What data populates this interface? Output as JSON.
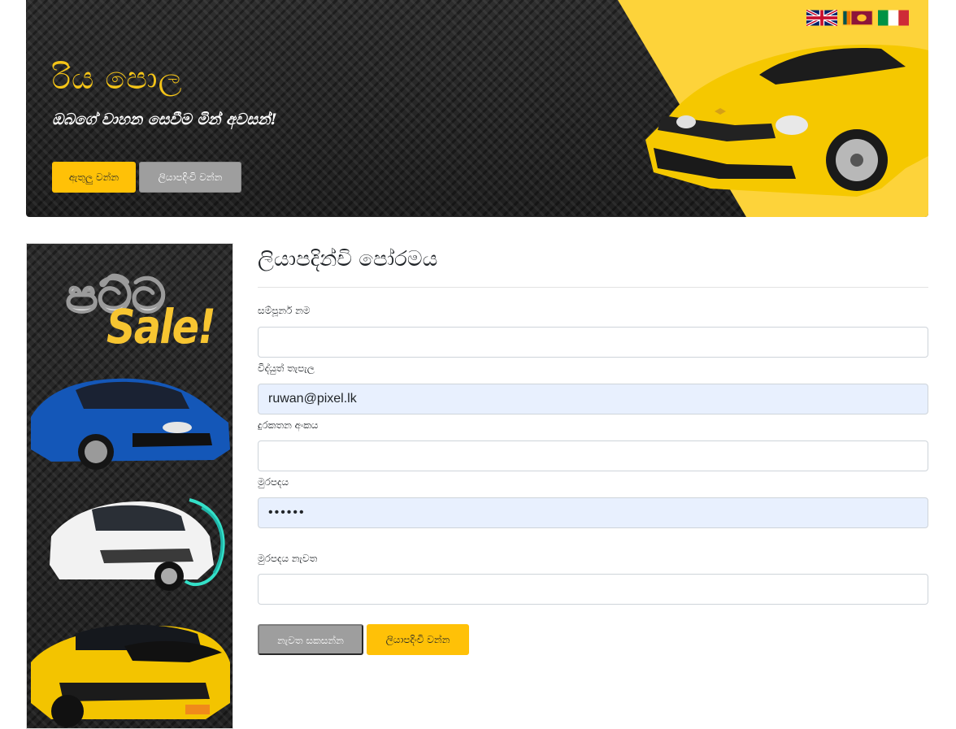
{
  "banner": {
    "title": "රිය පොල",
    "subtitle": "ඔබගේ වාහන සෙවීම මින් අවසන්!",
    "login_label": "ඇතුලු වන්න",
    "register_label": "ලියාපදිංචි වන්න",
    "flags": [
      "uk-flag",
      "sri-lanka-flag",
      "italy-flag"
    ]
  },
  "side_ad": {
    "text_sinhala": "පට්ට",
    "text_sale": "Sale!"
  },
  "form": {
    "title": "ලියාපදින්චි පෝරමය",
    "fields": [
      {
        "label": "සම්පූර්න නම",
        "value": "",
        "type": "text"
      },
      {
        "label": "විද්යුත් තැපැල",
        "value": "ruwan@pixel.lk",
        "type": "email"
      },
      {
        "label": "දුරකතන අංකය",
        "value": "",
        "type": "tel"
      },
      {
        "label": "මුරපදය",
        "value": "••••••",
        "type": "password"
      },
      {
        "label": "මුරපදය නැවත",
        "value": "",
        "type": "password"
      }
    ],
    "reset_label": "නැවත සකසන්න",
    "submit_label": "ලියාපදිංචි වන්න"
  },
  "colors": {
    "accent": "#ffc107",
    "banner_yellow": "#fdd33a",
    "title_gold": "#f5c518",
    "autofill": "#e8f0fe"
  }
}
